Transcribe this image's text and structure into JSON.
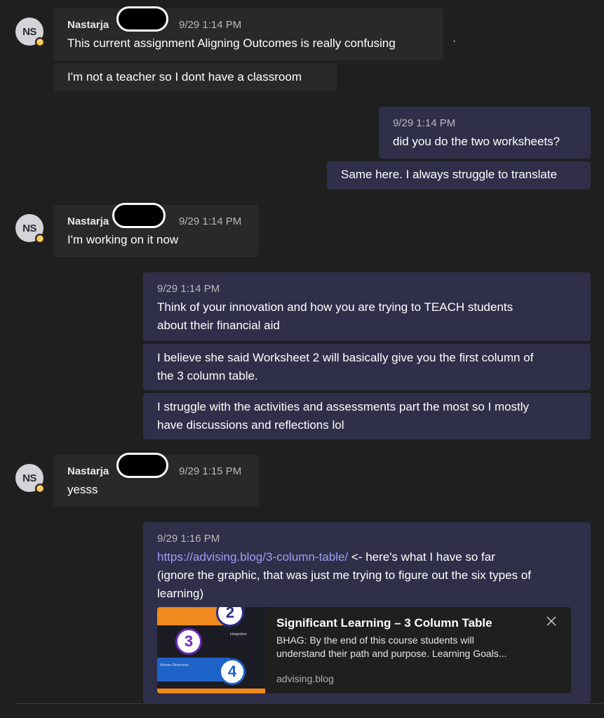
{
  "messages": [
    {
      "sender": "Nastarja",
      "initials": "NS",
      "time": "9/29 1:14 PM",
      "lines": [
        "This current assignment Aligning Outcomes is really confusing",
        "I'm not a teacher so I dont have a classroom"
      ]
    },
    {
      "time": "9/29 1:14 PM",
      "lines": [
        "did you do the two worksheets?",
        "Same here. I always struggle to translate"
      ]
    },
    {
      "sender": "Nastarja",
      "initials": "NS",
      "time": "9/29 1:14 PM",
      "lines": [
        "I'm working on it now"
      ]
    },
    {
      "time": "9/29 1:14 PM",
      "lines": [
        "Think of your innovation and how you are trying to TEACH students",
        "about their financial aid",
        "I believe she said Worksheet 2 will basically give you the first column of",
        "the 3 column table.",
        "I struggle with the activities and assessments part the most so I mostly",
        "have discussions and reflections lol"
      ]
    },
    {
      "sender": "Nastarja",
      "initials": "NS",
      "time": "9/29 1:15 PM",
      "lines": [
        "yesss"
      ]
    },
    {
      "time": "9/29 1:16 PM",
      "link": "https://advising.blog/3-column-table/",
      "after_link": " <- here's what I have so far",
      "lines": [
        "(ignore the graphic, that was just me trying to figure out the six types of",
        "learning)"
      ]
    }
  ],
  "preview": {
    "title": "Significant Learning – 3 Column Table",
    "description_line1": "BHAG: By the end of this course students will",
    "description_line2": "understand their path and purpose. Learning Goals...",
    "domain": "advising.blog",
    "close": "×",
    "graphic_numbers": [
      "2",
      "3",
      "4"
    ],
    "graphic_labels": [
      "Integration",
      "Human Dimension"
    ]
  },
  "stray_mark": "·"
}
